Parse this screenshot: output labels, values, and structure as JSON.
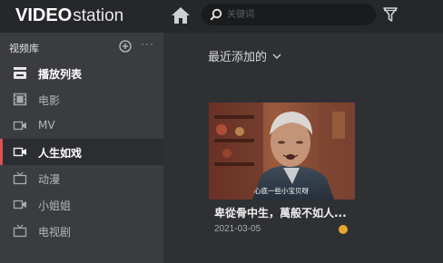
{
  "app": {
    "logo_video": "VIDEO",
    "logo_station": "station"
  },
  "search": {
    "placeholder": "关键词"
  },
  "sidebar": {
    "title": "视频库",
    "more_label": "···",
    "items": [
      {
        "label": "播放列表",
        "icon": "playlist-icon"
      },
      {
        "label": "电影",
        "icon": "film-icon"
      },
      {
        "label": "MV",
        "icon": "video-camera-icon"
      },
      {
        "label": "人生如戏",
        "icon": "video-camera-icon"
      },
      {
        "label": "动漫",
        "icon": "tv-icon"
      },
      {
        "label": "小姐姐",
        "icon": "video-camera-icon"
      },
      {
        "label": "电视剧",
        "icon": "tv-icon"
      }
    ]
  },
  "main": {
    "section_title": "最近添加的",
    "videos": [
      {
        "title": "卑從骨中生，萬般不如人...",
        "date": "2021-03-05",
        "subtitle_text": "心底一些小宝贝呀",
        "status_color": "#e5a630"
      }
    ]
  },
  "colors": {
    "accent": "#d9534f",
    "status_dot": "#e5a630"
  }
}
